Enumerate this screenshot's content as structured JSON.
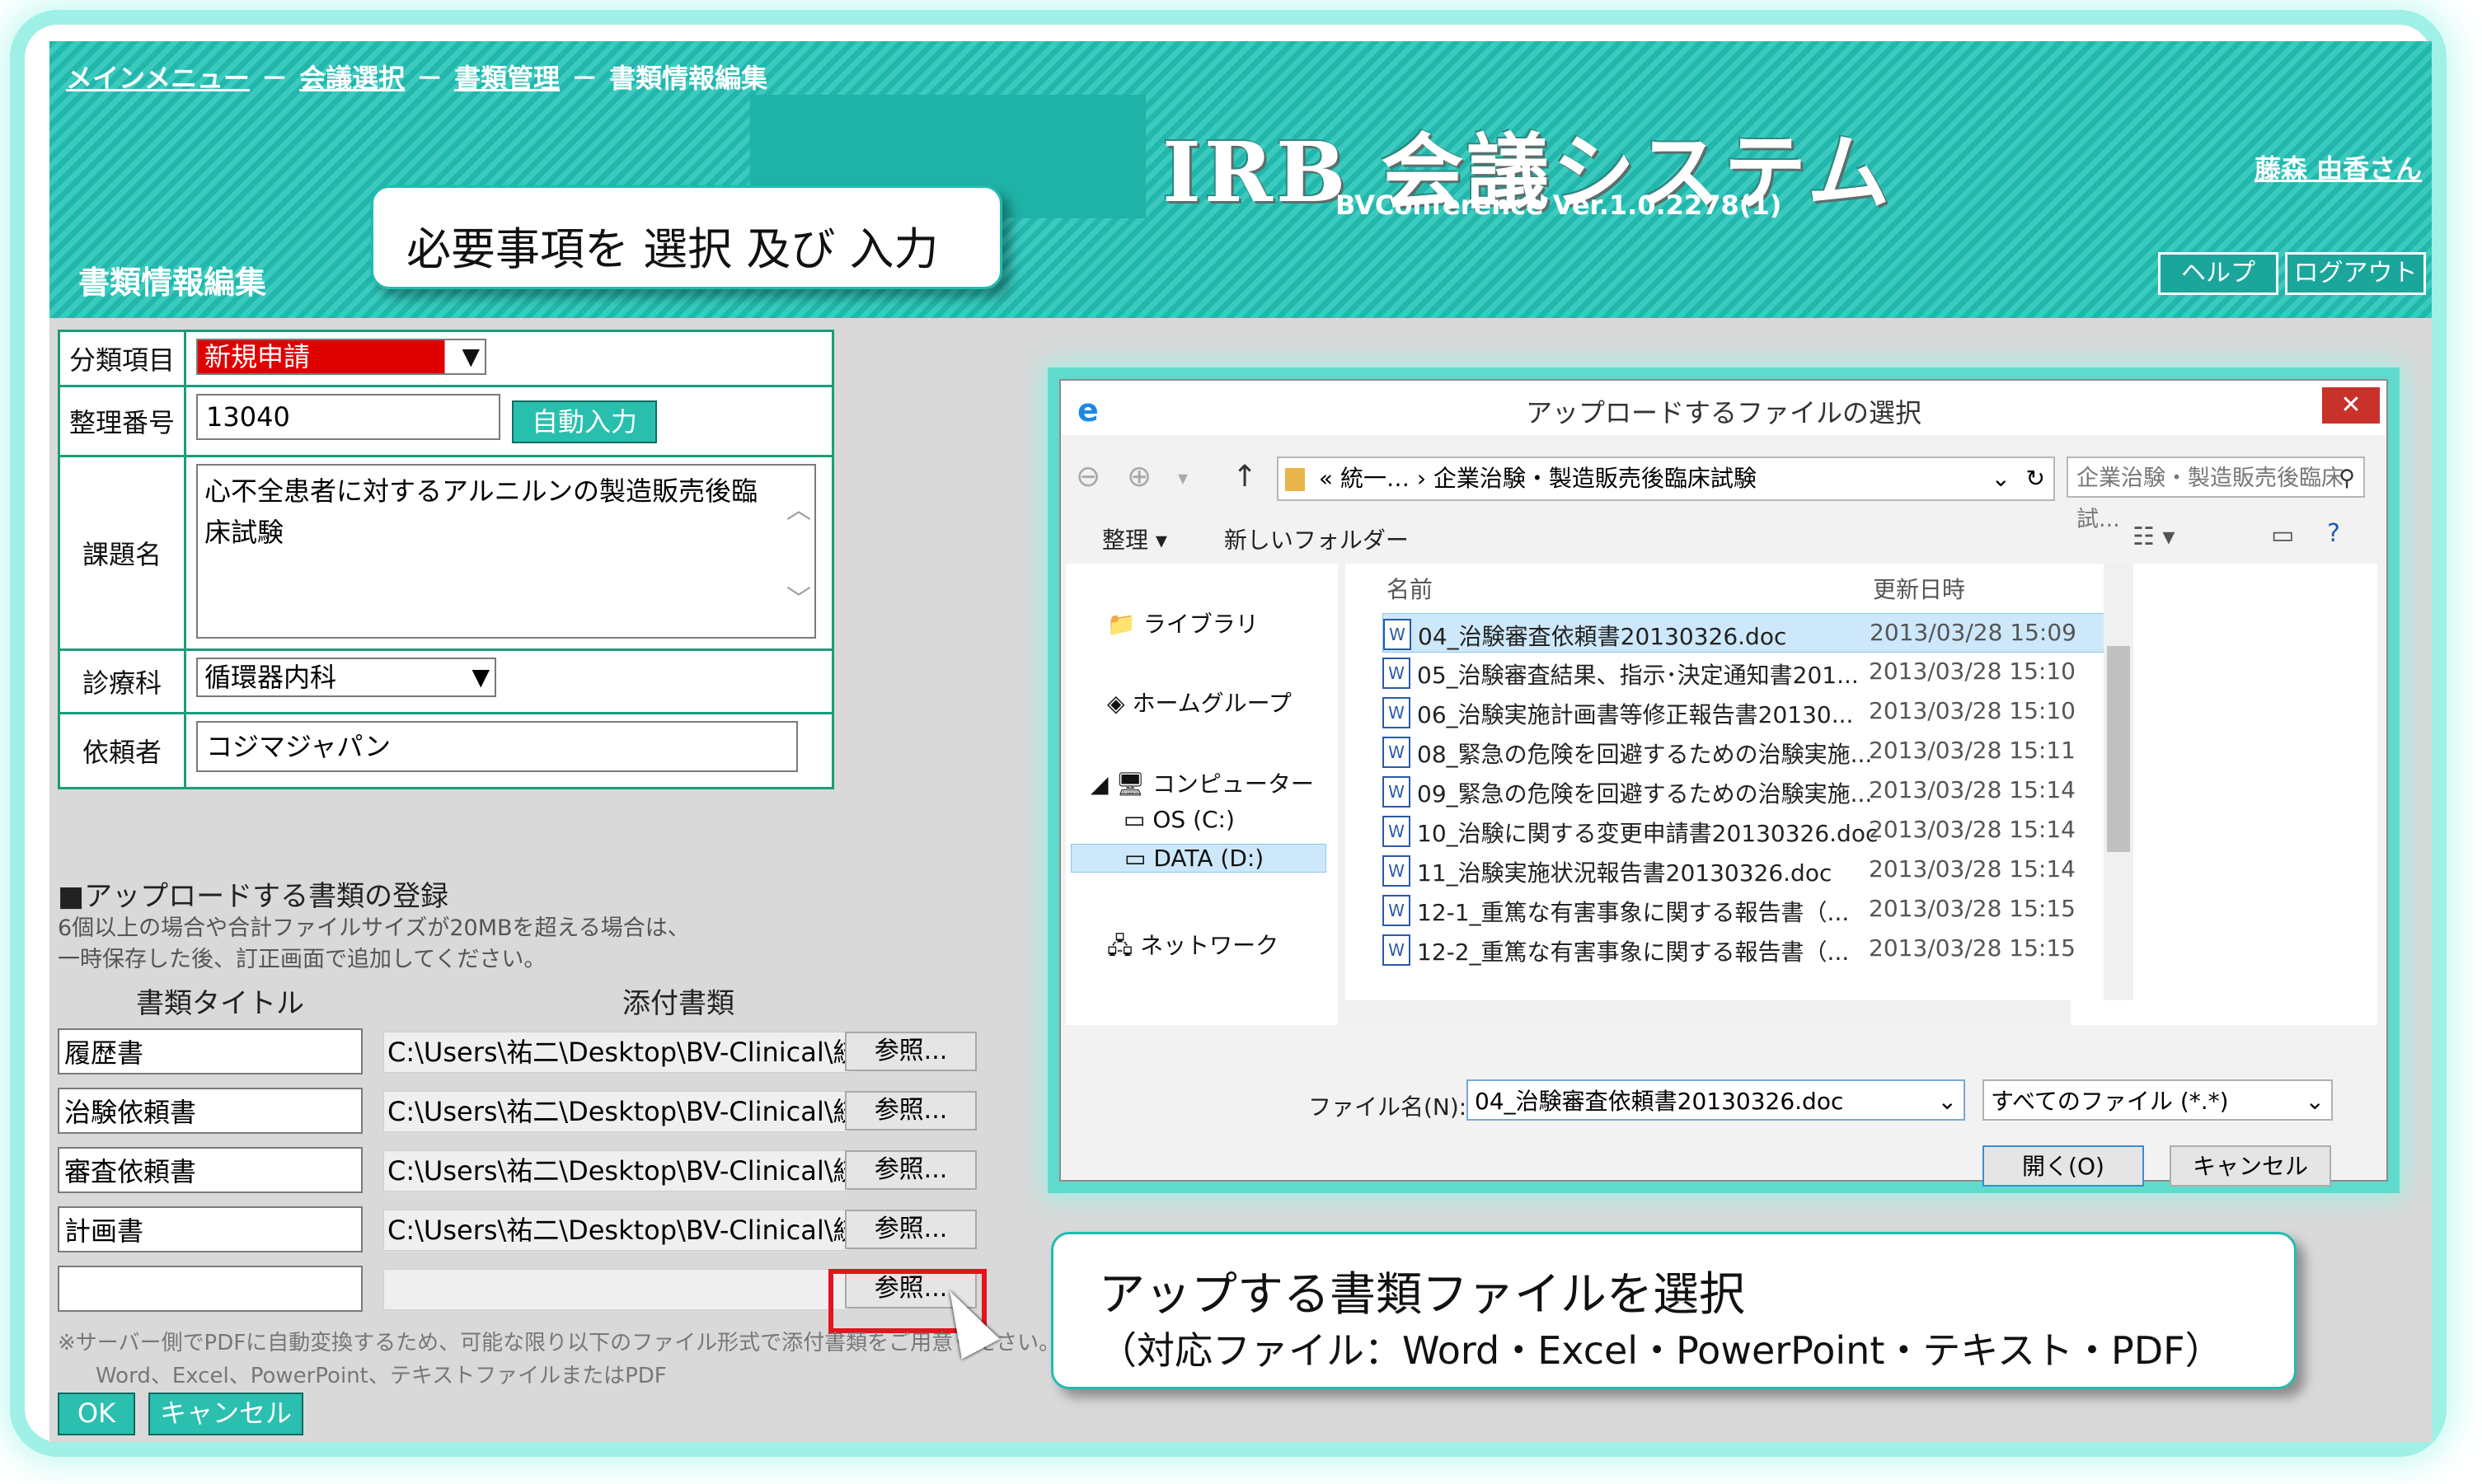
{
  "breadcrumb": {
    "items": [
      "メインメニュー",
      "会議選択",
      "書類管理"
    ],
    "current": "書類情報編集",
    "separator": "－"
  },
  "app": {
    "logo": "IRB 会議システム",
    "version": "BVConference Ver.1.0.2278(1)",
    "user": "藤森 由香さん",
    "help_label": "ヘルプ",
    "logout_label": "ログアウト",
    "page_title": "書類情報編集"
  },
  "callouts": {
    "top": "必要事項を 選択 及び 入力",
    "bottom_line1": "アップする書類ファイルを選択",
    "bottom_line2": "（対応ファイル：Word・Excel・PowerPoint・テキスト・PDF）"
  },
  "form": {
    "category_label": "分類項目",
    "category_value": "新規申請",
    "number_label": "整理番号",
    "number_value": "13040",
    "auto_input_label": "自動入力",
    "subject_label": "課題名",
    "subject_value": "心不全患者に対するアルニルンの製造販売後臨床試験",
    "dept_label": "診療科",
    "dept_value": "循環器内科",
    "requester_label": "依頼者",
    "requester_value": "コジマジャパン"
  },
  "upload": {
    "section_title": "■アップロードする書類の登録",
    "note_line1": "6個以上の場合や合計ファイルサイズが20MBを超える場合は、",
    "note_line2": "一時保存した後、訂正画面で追加してください。",
    "col_title": "書類タイトル",
    "col_file": "添付書類",
    "browse_label": "参照...",
    "rows": [
      {
        "title": "履歴書",
        "path": "C:\\Users\\祐二\\Desktop\\BV-Clinical\\統一"
      },
      {
        "title": "治験依頼書",
        "path": "C:\\Users\\祐二\\Desktop\\BV-Clinical\\統一"
      },
      {
        "title": "審査依頼書",
        "path": "C:\\Users\\祐二\\Desktop\\BV-Clinical\\統一"
      },
      {
        "title": "計画書",
        "path": "C:\\Users\\祐二\\Desktop\\BV-Clinical\\統一"
      },
      {
        "title": "",
        "path": ""
      }
    ],
    "note2_line1": "※サーバー側でPDFに自動変換するため、可能な限り以下のファイル形式で添付書類をご用意ください。",
    "note2_line2": "Word、Excel、PowerPoint、テキストファイルまたはPDF",
    "ok_label": "OK",
    "cancel_label": "キャンセル"
  },
  "dialog": {
    "title": "アップロードするファイルの選択",
    "address": "«  統一…  ›  企業治験・製造販売後臨床試験",
    "search_placeholder": "企業治験・製造販売後臨床試...",
    "organize": "整理 ▾",
    "new_folder": "新しいフォルダー",
    "nav": [
      {
        "label": "ライブラリ"
      },
      {
        "label": "ホームグループ"
      },
      {
        "label": "コンピューター"
      },
      {
        "label": "OS (C:)"
      },
      {
        "label": "DATA (D:)"
      },
      {
        "label": "ネットワーク"
      }
    ],
    "col_name": "名前",
    "col_date": "更新日時",
    "files": [
      {
        "name": "04_治験審査依頼書20130326.doc",
        "date": "2013/03/28 15:09"
      },
      {
        "name": "05_治験審査結果、指示･決定通知書201...",
        "date": "2013/03/28 15:10"
      },
      {
        "name": "06_治験実施計画書等修正報告書20130...",
        "date": "2013/03/28 15:10"
      },
      {
        "name": "08_緊急の危険を回避するための治験実施...",
        "date": "2013/03/28 15:11"
      },
      {
        "name": "09_緊急の危険を回避するための治験実施...",
        "date": "2013/03/28 15:14"
      },
      {
        "name": "10_治験に関する変更申請書20130326.doc",
        "date": "2013/03/28 15:14"
      },
      {
        "name": "11_治験実施状況報告書20130326.doc",
        "date": "2013/03/28 15:14"
      },
      {
        "name": "12-1_重篤な有害事象に関する報告書（...",
        "date": "2013/03/28 15:15"
      },
      {
        "name": "12-2_重篤な有害事象に関する報告書（...",
        "date": "2013/03/28 15:15"
      }
    ],
    "filename_label": "ファイル名(N):",
    "filename_value": "04_治験審査依頼書20130326.doc",
    "filetype_value": "すべてのファイル (*.*)",
    "open_label": "開く(O)",
    "cancel_label": "キャンセル"
  },
  "colors": {
    "header_teal": "#22b7ad",
    "category_red": "#e00000",
    "highlight_red": "#e4141c",
    "button_teal": "#29bfae"
  }
}
